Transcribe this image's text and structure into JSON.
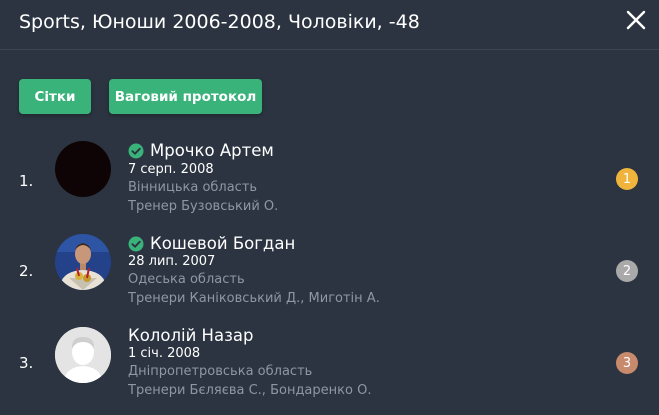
{
  "header": {
    "title": "Sports, Юноши 2006-2008, Чоловіки, -48",
    "close_icon": "close-icon"
  },
  "actions": {
    "brackets_label": "Сітки",
    "weigh_in_label": "Ваговий протокол",
    "button_color": "#3ab37b"
  },
  "results": [
    {
      "place": "1.",
      "name": "Мрочко Артем",
      "verified": true,
      "dob": "7 серп. 2008",
      "region": "Вінницька область",
      "coach": "Тренер Бузовський О.",
      "medal": "1",
      "medal_color": "#f0b43c",
      "avatar": "black-placeholder"
    },
    {
      "place": "2.",
      "name": "Кошевой Богдан",
      "verified": true,
      "dob": "28 лип. 2007",
      "region": "Одеська область",
      "coach": "Тренери Каніковський Д.,  Миготін А.",
      "medal": "2",
      "medal_color": "#a9a9a9",
      "avatar": "athlete-photo"
    },
    {
      "place": "3.",
      "name": "Кололій Назар",
      "verified": false,
      "dob": "1 січ. 2008",
      "region": "Дніпропетровська область",
      "coach": "Тренери Бєляєва С.,  Бондаренко О.",
      "medal": "3",
      "medal_color": "#c88a6c",
      "avatar": "default-user-avatar"
    }
  ]
}
